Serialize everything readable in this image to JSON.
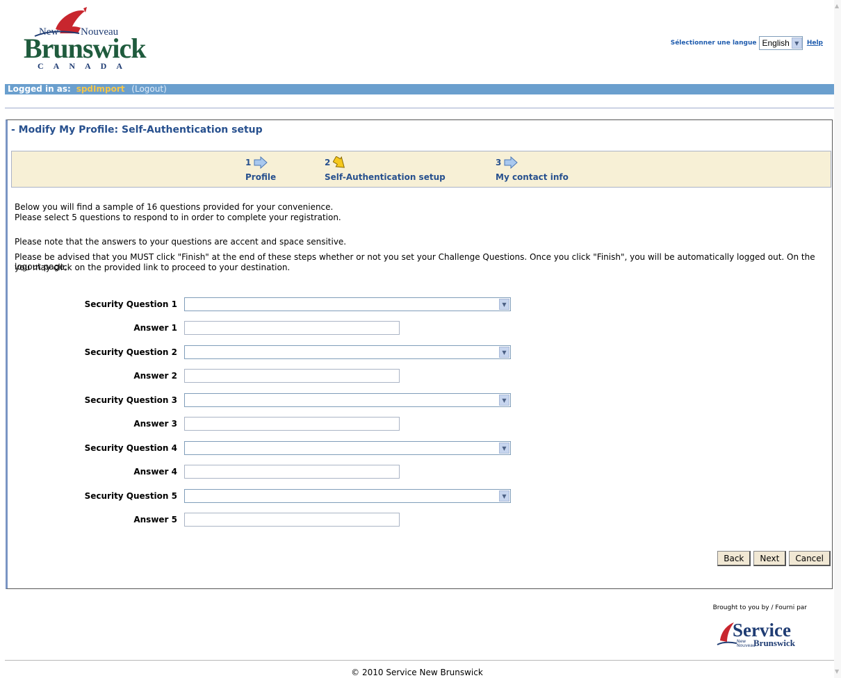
{
  "header": {
    "logo": {
      "new": "New",
      "nouveau": "Nouveau",
      "brand": "Brunswick",
      "country": "CANADA"
    },
    "language_label": "Sélectionner une langue",
    "language_value": "English",
    "help_label": "Help"
  },
  "login": {
    "label": "Logged in as:",
    "username": "spdImport",
    "logout": "(Logout)"
  },
  "page": {
    "title": "- Modify My Profile: Self-Authentication setup"
  },
  "wizard": {
    "steps": [
      {
        "num": "1",
        "label": "Profile",
        "icon": "arrow-right-icon",
        "active": false
      },
      {
        "num": "2",
        "label": "Self-Authentication setup",
        "icon": "arrow-down-icon",
        "active": true
      },
      {
        "num": "3",
        "label": "My contact info",
        "icon": "arrow-right-icon",
        "active": false
      }
    ]
  },
  "intro": {
    "line1": "Below you will find a sample of 16 questions provided for your convenience.",
    "line2": "Please select 5 questions to respond to in order to complete your registration.",
    "note": "Please note that the answers to your questions are accent and space sensitive.",
    "advise1": "Please be advised that you MUST click \"Finish\" at the end of these steps whether or not you set your Challenge Questions. Once you click \"Finish\", you will be automatically logged out. On the logout page,",
    "advise2": "you may click on the provided link to proceed to your destination."
  },
  "form": {
    "q1_label": "Security Question 1",
    "a1_label": "Answer 1",
    "q2_label": "Security Question 2",
    "a2_label": "Answer 2",
    "q3_label": "Security Question 3",
    "a3_label": "Answer 3",
    "q4_label": "Security Question 4",
    "a4_label": "Answer 4",
    "q5_label": "Security Question 5",
    "a5_label": "Answer 5"
  },
  "buttons": {
    "back": "Back",
    "next": "Next",
    "cancel": "Cancel"
  },
  "footer": {
    "brought": "Brought to you by / Fourni par",
    "service_word": "Service",
    "service_new": "New",
    "service_nouveau": "Nouveau",
    "service_brunswick": "Brunswick",
    "copyright": "© 2010 Service New Brunswick"
  },
  "colors": {
    "accent": "#27508e",
    "bar": "#6a9fce",
    "username": "#f5c64a",
    "wizard_bg": "#f7f0d6",
    "active_arrow": "#f5c81e",
    "arrow": "#a9c8ee"
  }
}
